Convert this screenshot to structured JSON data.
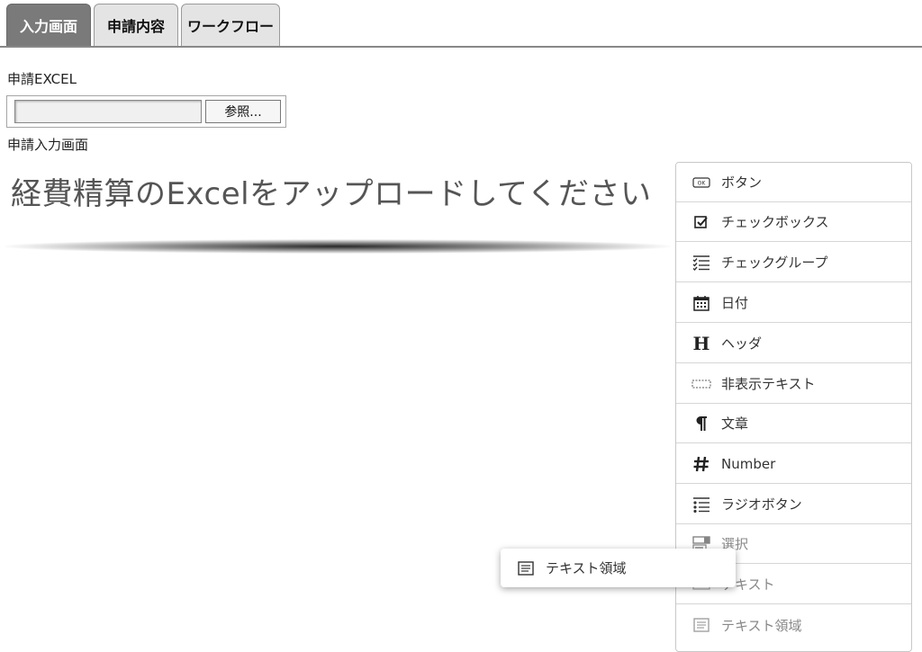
{
  "tabs": [
    {
      "label": "入力画面",
      "active": true
    },
    {
      "label": "申請内容",
      "active": false
    },
    {
      "label": "ワークフロー",
      "active": false
    }
  ],
  "upload": {
    "label": "申請EXCEL",
    "file_value": "",
    "browse_label": "参照..."
  },
  "form": {
    "section_label": "申請入力画面",
    "title": "経費精算のExcelをアップロードしてください"
  },
  "palette": {
    "items": [
      {
        "label": "ボタン",
        "icon": "button-icon"
      },
      {
        "label": "チェックボックス",
        "icon": "checkbox-icon"
      },
      {
        "label": "チェックグループ",
        "icon": "checklist-icon"
      },
      {
        "label": "日付",
        "icon": "calendar-icon"
      },
      {
        "label": "ヘッダ",
        "icon": "header-icon"
      },
      {
        "label": "非表示テキスト",
        "icon": "hidden-text-icon"
      },
      {
        "label": "文章",
        "icon": "paragraph-icon"
      },
      {
        "label": "Number",
        "icon": "hash-icon"
      },
      {
        "label": "ラジオボタン",
        "icon": "radio-list-icon"
      },
      {
        "label": "選択",
        "icon": "select-icon"
      },
      {
        "label": "テキスト",
        "icon": "text-field-icon"
      },
      {
        "label": "テキスト領域",
        "icon": "textarea-icon"
      }
    ]
  },
  "drag_item": {
    "label": "テキスト領域",
    "icon": "textarea-icon"
  }
}
